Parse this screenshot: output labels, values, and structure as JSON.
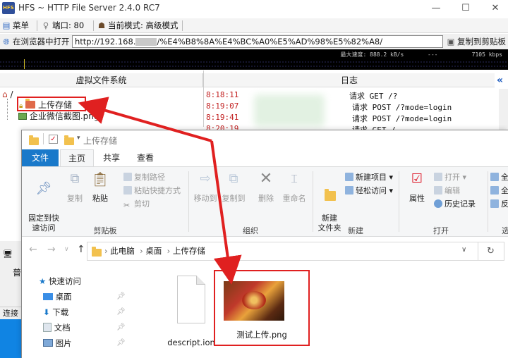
{
  "hfs": {
    "title": "HFS ~ HTTP File Server 2.4.0 RC7",
    "logo_text": "HFS",
    "window_controls": [
      "—",
      "☐",
      "✕"
    ],
    "toolbar": {
      "menu": "菜单",
      "port": "端口: 80",
      "mode": "当前模式: 高级模式"
    },
    "urlbar": {
      "open_browser": "在浏览器中打开",
      "url_prefix": "http://192.168.",
      "url_suffix": "/%E4%B8%8A%E4%BC%A0%E5%AD%98%E5%82%A8/",
      "copy_clipboard": "复制到剪贴板"
    },
    "graph": {
      "max_speed": "最大速度: 888.2 kB/s",
      "dashes": "---",
      "current_speed": "7105 kbps"
    },
    "panes": {
      "vfs_header": "虚拟文件系统",
      "log_header": "日志",
      "log_toggle": "«"
    },
    "vfs": {
      "root": "/",
      "folder": "上传存储",
      "file": "企业微信截图.png"
    },
    "log": [
      {
        "time": "8:18:11",
        "msg": "请求 GET /?"
      },
      {
        "time": "8:19:07",
        "msg": "请求 POST /?mode=login"
      },
      {
        "time": "8:19:41",
        "msg": "请求 POST /?mode=login"
      },
      {
        "time": "8:20:19",
        "msg": "请求 GET /"
      }
    ],
    "left_edge": {
      "label_a": "普",
      "connections": "连接"
    }
  },
  "explorer": {
    "title": "上传存储",
    "tabs": {
      "file": "文件",
      "home": "主页",
      "share": "共享",
      "view": "查看"
    },
    "ribbon": {
      "pin_quick": "固定到快\n速访问",
      "copy": "复制",
      "paste": "粘贴",
      "copy_path": "复制路径",
      "paste_shortcut": "粘贴快捷方式",
      "cut": "剪切",
      "clipboard_group": "剪贴板",
      "move_to": "移动到",
      "copy_to": "复制到",
      "delete": "删除",
      "rename": "重命名",
      "organize_group": "组织",
      "new_item": "新建项目",
      "easy_access": "轻松访问",
      "new_folder": "新建\n文件夹",
      "new_group": "新建",
      "properties": "属性",
      "open": "打开",
      "edit": "编辑",
      "history": "历史记录",
      "open_group": "打开",
      "select_all": "全",
      "select_none": "全",
      "invert": "反",
      "select_group": "选"
    },
    "address": {
      "segments": [
        "此电脑",
        "桌面",
        "上传存储"
      ]
    },
    "nav": {
      "quick_access": "快速访问",
      "desktop": "桌面",
      "downloads": "下载",
      "documents": "文档",
      "pictures": "图片"
    },
    "files": [
      {
        "name": "descript.ion"
      },
      {
        "name": "测试上传.png"
      }
    ]
  },
  "colors": {
    "accent": "#1979ca",
    "highlight": "#e02020",
    "folder": "#f2c14e"
  }
}
